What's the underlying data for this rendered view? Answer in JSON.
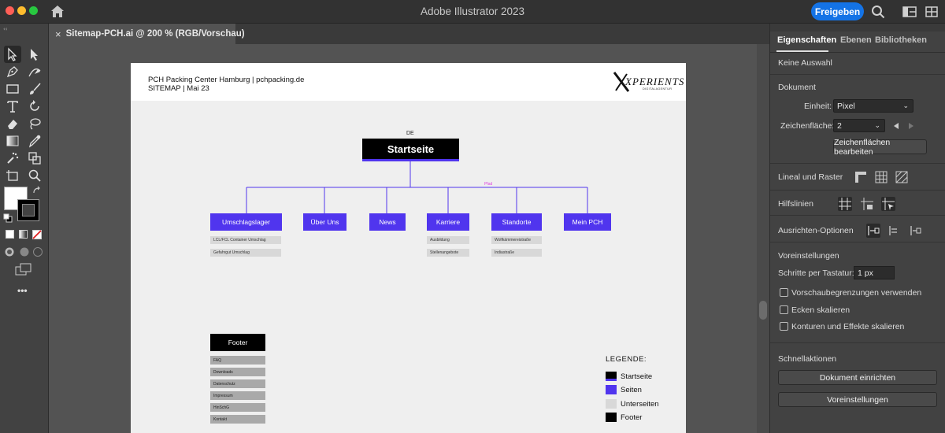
{
  "window": {
    "title": "Adobe Illustrator 2023",
    "share_label": "Freigeben"
  },
  "colors": {
    "accent_purple": "#5035ee",
    "share_blue": "#1473e6",
    "pfad_magenta": "#e040e0"
  },
  "icons": [
    "home-icon",
    "search-icon",
    "workspace-icon",
    "arrange-icon",
    "selection-icon",
    "direct-selection-icon",
    "pen-icon",
    "curvature-icon",
    "rectangle-icon",
    "paintbrush-icon",
    "type-icon",
    "rotate-icon",
    "eraser-icon",
    "lasso-icon",
    "gradient-icon",
    "eyedropper-icon",
    "symbol-sprayer-icon",
    "shape-builder-icon",
    "artboard-icon",
    "zoom-icon",
    "swap-icon",
    "default-colors-icon",
    "change-screen-mode-icon",
    "more-tools-icon"
  ],
  "tools": {
    "more_label": "•••"
  },
  "document": {
    "close_glyph": "×",
    "tab_name": "Sitemap-PCH.ai @ 200 % (RGB/Vorschau)"
  },
  "artboard": {
    "header_line1": "PCH Packing Center Hamburg | pchpacking.de",
    "header_line2": "SITEMAP | Mai 23",
    "logo_text": "XPERIENTS",
    "logo_sub": "DIGITALAGENTUR",
    "lang_label": "DE",
    "start_label": "Startseite",
    "pfad_label": "Pfad",
    "pages": [
      {
        "label": "Umschlagslager",
        "subpages": [
          "LCL/FCL Container Umschlag",
          "Gefahrgut Umschlag"
        ]
      },
      {
        "label": "Über Uns",
        "subpages": []
      },
      {
        "label": "News",
        "subpages": []
      },
      {
        "label": "Karriere",
        "subpages": [
          "Ausbildung",
          "Stellenangebote"
        ]
      },
      {
        "label": "Standorte",
        "subpages": [
          "Wolfkämmereistraße",
          "Indiastraße"
        ]
      },
      {
        "label": "Mein PCH",
        "subpages": []
      }
    ],
    "footer_label": "Footer",
    "footer_items": [
      "FAQ",
      "Downloads",
      "Datenschutz",
      "Impressum",
      "HinSchG",
      "Kontakt"
    ],
    "legend_title": "LEGENDE:",
    "legend": [
      {
        "label": "Startseite",
        "color": "#000000",
        "accent": "#5035ee"
      },
      {
        "label": "Seiten",
        "color": "#5035ee"
      },
      {
        "label": "Unterseiten",
        "color": "#d8d8d8"
      },
      {
        "label": "Footer",
        "color": "#000000"
      }
    ]
  },
  "panel": {
    "tabs": [
      "Eigenschaften",
      "Ebenen",
      "Bibliotheken"
    ],
    "no_selection": "Keine Auswahl",
    "document_heading": "Dokument",
    "unit_label": "Einheit:",
    "unit_value": "Pixel",
    "artboard_label": "Zeichenfläche:",
    "artboard_value": "2",
    "edit_artboards": "Zeichenflächen bearbeiten",
    "rulers_grids": "Lineal und Raster",
    "guides": "Hilfslinien",
    "snap_options": "Ausrichten-Optionen",
    "preferences_heading": "Voreinstellungen",
    "keyboard_increment_label": "Schritte per Tastatur:",
    "keyboard_increment_value": "1 px",
    "checkboxes": [
      "Vorschaubegrenzungen verwenden",
      "Ecken skalieren",
      "Konturen und Effekte skalieren"
    ],
    "quick_actions": "Schnellaktionen",
    "document_setup": "Dokument einrichten",
    "preferences_button": "Voreinstellungen"
  }
}
